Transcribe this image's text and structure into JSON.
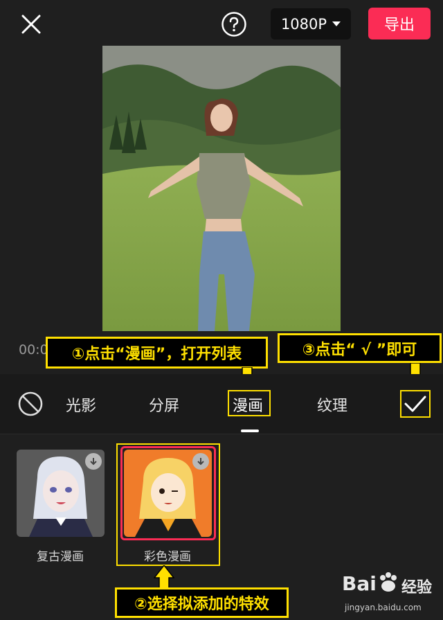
{
  "topbar": {
    "resolution": "1080P",
    "export_label": "导出"
  },
  "preview": {
    "timecode": "00:0"
  },
  "callouts": {
    "step1": "①点击“漫画”，打开列表",
    "step2": "②选择拟添加的特效",
    "step3": "③点击“ √ ”即可"
  },
  "tabs": [
    {
      "label": "光影"
    },
    {
      "label": "分屏"
    },
    {
      "label": "漫画",
      "active": true
    },
    {
      "label": "纹理"
    }
  ],
  "effects": [
    {
      "label": "复古漫画"
    },
    {
      "label": "彩色漫画",
      "selected": true
    }
  ],
  "watermark": {
    "brand": "Bai",
    "brand2": "经验",
    "url": "jingyan.baidu.com"
  },
  "colors": {
    "accent": "#fb2c55",
    "callout": "#ffe000",
    "background": "#1f1f1f"
  }
}
